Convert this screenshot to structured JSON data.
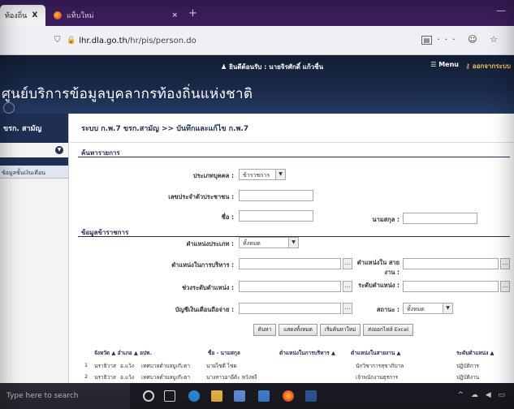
{
  "browser": {
    "tabs": [
      {
        "label": "ท้องถิ่น",
        "close": "X"
      },
      {
        "label": "แท็บใหม่",
        "close": "×"
      }
    ],
    "newtab": "+",
    "url_host": "lhr.dla.go.th",
    "url_path": "/hr/pis/person.do",
    "nav_icons": "··· ☺ ☆"
  },
  "header": {
    "user_label": "ยินดีต้อนรับ : นายจิรศักดิ์ แก้วชื่น",
    "menu_label": "Menu",
    "logout_label": "ออกจากระบบ",
    "site_title": "ศูนย์บริการข้อมูลบุคลากรท้องถิ่นแห่งชาติ"
  },
  "sidebar": {
    "title": "ขรก. สามัญ",
    "toggle": "▼",
    "items": [
      "ข้อมูลขั้นเงินเดือน"
    ]
  },
  "breadcrumb": "ระบบ ก.พ.7 ขรก.สามัญ >> บันทึกและแก้ไข ก.พ.7",
  "search_section": {
    "title": "ค้นหารายการ",
    "person_type_label": "ประเภทบุคคล :",
    "person_type_value": "ข้าราชการ",
    "id_label": "เลขประจำตัวประชาชน :",
    "name_label": "ชื่อ :",
    "surname_label": "นามสกุล :"
  },
  "gov_section": {
    "title": "ข้อมูลข้าราชการ",
    "position_type_label": "ตำแหน่งประเภท :",
    "position_type_value": "ทั้งหมด",
    "admin_position_label": "ตำแหน่งในการบริหาร :",
    "line_position_label": "ตำแหน่งใน สายงาน :",
    "level_range_label": "ช่วงระดับตำแหน่ง :",
    "level_label": "ระดับตำแหน่ง :",
    "salary_account_label": "บัญชีเงินเดือนถือจ่าย :",
    "status_label": "สถานะ :",
    "status_value": "ทั้งหมด",
    "dots": "..."
  },
  "buttons": {
    "search": "ค้นหา",
    "show_all": "แสดงทั้งหมด",
    "add_new": "เริ่มค้นหาใหม่",
    "export_excel": "ส่งออกไฟล์ Excel"
  },
  "table": {
    "headers": [
      "จังหวัด ▲ อำเภอ ▲ อปท.",
      "ชื่อ - นามสกุล",
      "ตำแหน่งในการบริหาร ▲",
      "ตำแหน่งในสายงาน ▲",
      "ระดับตำแหน่ง ▲"
    ],
    "rows": [
      [
        "1",
        "นราธิวาส",
        "อ.แว้ง",
        "เทศบาลตำบลบูเก๊ะตา",
        "นายไซดี ไซด",
        "นักวิชาการสุขาภิบาล",
        "ปฏิบัติการ"
      ],
      [
        "2",
        "นราธิวาส",
        "อ.แว้ง",
        "เทศบาลตำบลบูเก๊ะตา",
        "นางสาวอาอีด้ะ หวังหงี",
        "เจ้าพนักงานธุรการ",
        "ปฏิบัติงาน"
      ]
    ]
  },
  "taskbar": {
    "search_placeholder": "Type here to search",
    "tray": "^ ☁ ◀ ▭"
  },
  "colors": {
    "header_bg": "#1b2a4a",
    "tabbar_bg": "#3b1e5c",
    "accent_gold": "#f3c34c"
  }
}
